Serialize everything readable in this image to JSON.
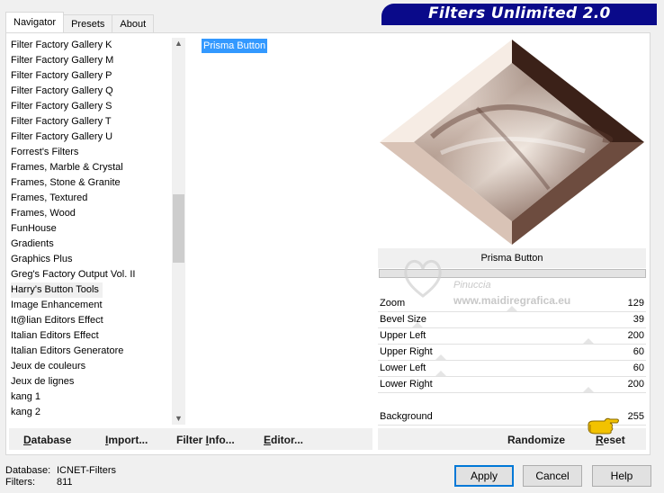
{
  "tabs": [
    {
      "label": "Navigator",
      "active": true
    },
    {
      "label": "Presets",
      "active": false
    },
    {
      "label": "About",
      "active": false
    }
  ],
  "banner": {
    "title": "Filters Unlimited 2.0"
  },
  "categories": [
    "Filter Factory Gallery K",
    "Filter Factory Gallery M",
    "Filter Factory Gallery P",
    "Filter Factory Gallery Q",
    "Filter Factory Gallery S",
    "Filter Factory Gallery T",
    "Filter Factory Gallery U",
    "Forrest's Filters",
    "Frames, Marble & Crystal",
    "Frames, Stone & Granite",
    "Frames, Textured",
    "Frames, Wood",
    "FunHouse",
    "Gradients",
    "Graphics Plus",
    "Greg's Factory Output Vol. II",
    "Harry's Button Tools",
    "Image Enhancement",
    "It@lian Editors Effect",
    "Italian Editors Effect",
    "Italian Editors Generatore",
    "Jeux de couleurs",
    "Jeux de lignes",
    "kang 1",
    "kang 2"
  ],
  "selected_category": "Harry's Button Tools",
  "filters": [
    "Prisma Button"
  ],
  "selected_filter": "Prisma Button",
  "preview": {
    "filter_name": "Prisma Button"
  },
  "watermark": {
    "name": "Pinuccia",
    "site": "www.maidiregrafica.eu"
  },
  "controls": [
    {
      "label": "Zoom",
      "value": "129"
    },
    {
      "label": "Bevel Size",
      "value": "39"
    },
    {
      "label": "Upper Left",
      "value": "200"
    },
    {
      "label": "Upper Right",
      "value": "60"
    },
    {
      "label": "Lower Left",
      "value": "60"
    },
    {
      "label": "Lower Right",
      "value": "200"
    },
    {
      "label": "Background",
      "value": "255"
    }
  ],
  "left_buttons": {
    "database": {
      "label": "Database",
      "underline": "D",
      "rest": "atabase"
    },
    "import": {
      "label": "Import...",
      "underline": "I",
      "rest": "mport..."
    },
    "filter_info": {
      "label": "Filter Info...",
      "pre": "Filter ",
      "underline": "I",
      "rest": "nfo..."
    },
    "editor": {
      "label": "Editor...",
      "underline": "E",
      "rest": "ditor..."
    }
  },
  "right_buttons": {
    "randomize": "Randomize",
    "reset": {
      "label": "Reset",
      "underline": "R",
      "rest": "eset"
    }
  },
  "status": {
    "database_label": "Database:",
    "database_value": "ICNET-Filters",
    "filters_label": "Filters:",
    "filters_value": "811"
  },
  "dialog_buttons": {
    "apply": "Apply",
    "cancel": "Cancel",
    "help": "Help"
  },
  "colors": {
    "banner": "#0a0a8a",
    "selection": "#3399ff",
    "default_button_border": "#0078d7"
  }
}
